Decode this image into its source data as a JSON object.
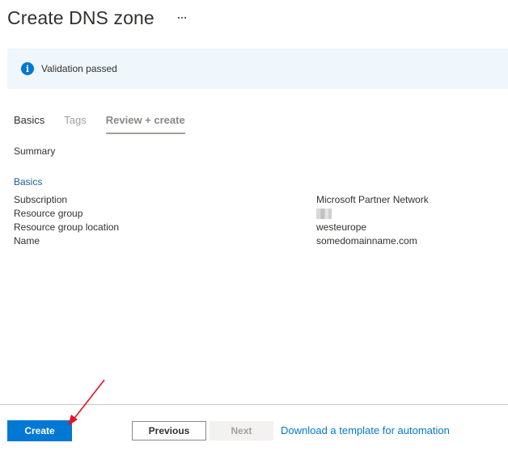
{
  "header": {
    "title": "Create DNS zone",
    "more_icon": "ellipsis-icon"
  },
  "banner": {
    "icon": "info-icon",
    "icon_glyph": "i",
    "text": "Validation passed",
    "accent": "#0078d4",
    "background": "#eff6fc"
  },
  "tabs": [
    {
      "label": "Basics",
      "state": "completed"
    },
    {
      "label": "Tags",
      "state": "disabled"
    },
    {
      "label": "Review + create",
      "state": "active"
    }
  ],
  "summary": {
    "heading": "Summary",
    "section_title": "Basics",
    "rows": [
      {
        "label": "Subscription",
        "value": "Microsoft Partner Network"
      },
      {
        "label": "Resource group",
        "value": ""
      },
      {
        "label": "Resource group location",
        "value": "westeurope"
      },
      {
        "label": "Name",
        "value": "somedomainname.com"
      }
    ]
  },
  "footer": {
    "create_label": "Create",
    "previous_label": "Previous",
    "next_label": "Next",
    "template_link": "Download a template for automation",
    "primary_color": "#0078d4"
  },
  "annotation": {
    "arrow_color": "#e81123"
  }
}
